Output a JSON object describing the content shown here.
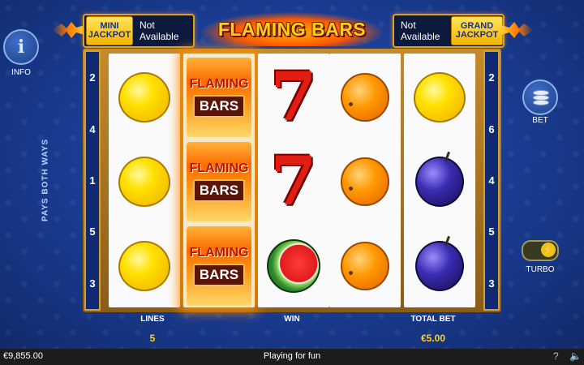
{
  "jackpots": {
    "mini": {
      "badge": "MINI JACKPOT",
      "value": "Not Available"
    },
    "grand": {
      "badge": "GRAND JACKPOT",
      "value": "Not Available"
    }
  },
  "title": "FLAMING BARS",
  "sidebar": {
    "info_label": "INFO",
    "bet_label": "BET",
    "turbo_label": "TURBO"
  },
  "paylines_left": [
    "2",
    "4",
    "1",
    "5",
    "3"
  ],
  "paylines_right": [
    "2",
    "6",
    "4",
    "5",
    "3"
  ],
  "pays_both_ways": "PAYS BOTH WAYS",
  "reels": [
    [
      "lemon",
      "lemon",
      "lemon"
    ],
    [
      "flaming-bars",
      "flaming-bars",
      "flaming-bars"
    ],
    [
      "seven",
      "seven",
      "watermelon"
    ],
    [
      "orange",
      "orange",
      "orange"
    ],
    [
      "lemon",
      "plum",
      "plum"
    ]
  ],
  "symbol_text": {
    "seven": "7",
    "fb_top": "FLAMING",
    "fb_bottom": "BARS"
  },
  "bottom": {
    "lines_label": "LINES",
    "lines_value": "5",
    "win_label": "WIN",
    "win_value": "",
    "total_bet_label": "TOTAL BET",
    "total_bet_value": "€5.00"
  },
  "status_bar": {
    "balance": "€9,855.00",
    "mode": "Playing for fun",
    "help": "?",
    "sound": "🔈"
  },
  "colors": {
    "accent": "#ffd21f",
    "background": "#1b4099",
    "frame": "#c58b2b"
  }
}
